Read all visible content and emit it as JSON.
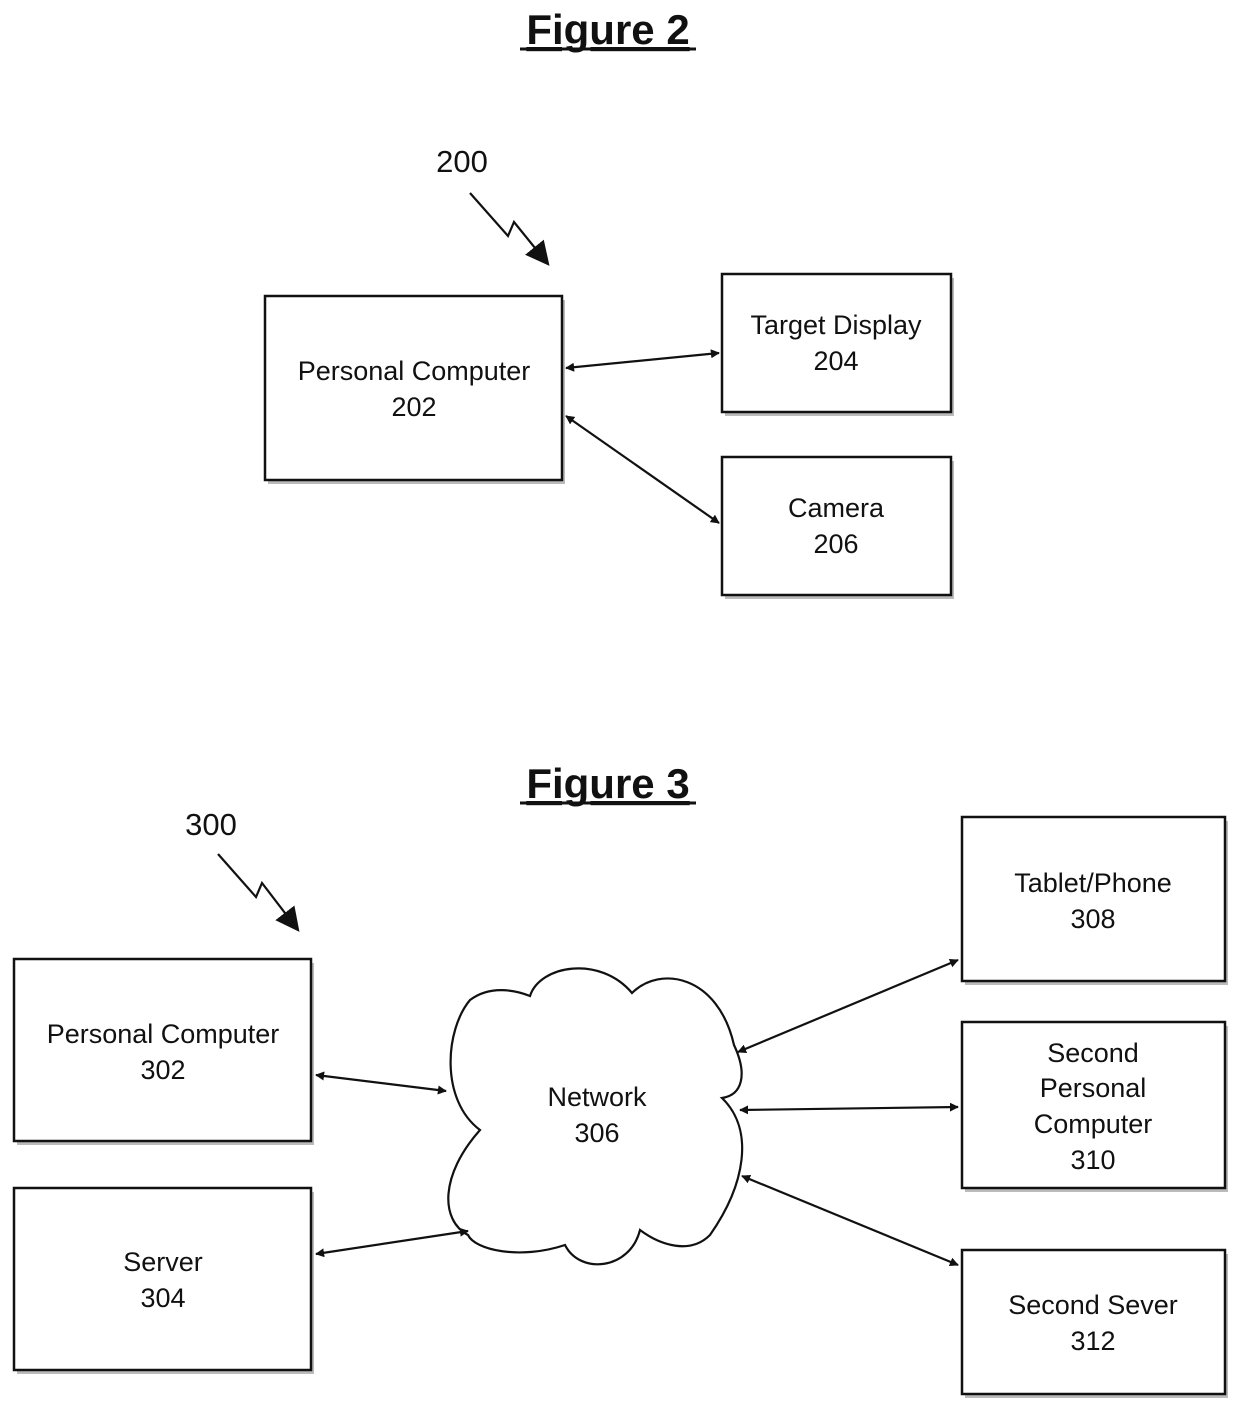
{
  "figure2": {
    "title": "Figure 2",
    "ref": "200",
    "nodes": {
      "pc": {
        "name": "Personal Computer",
        "num": "202"
      },
      "display": {
        "name": "Target Display",
        "num": "204"
      },
      "camera": {
        "name": "Camera",
        "num": "206"
      }
    },
    "edges": [
      {
        "from": "Personal Computer 202",
        "to": "Target Display 204",
        "direction": "bidirectional"
      },
      {
        "from": "Personal Computer 202",
        "to": "Camera 206",
        "direction": "bidirectional"
      }
    ]
  },
  "figure3": {
    "title": "Figure 3",
    "ref": "300",
    "nodes": {
      "pc": {
        "name": "Personal Computer",
        "num": "302"
      },
      "server": {
        "name": "Server",
        "num": "304"
      },
      "network": {
        "name": "Network",
        "num": "306"
      },
      "tablet": {
        "name": "Tablet/Phone",
        "num": "308"
      },
      "pc2": {
        "lines": [
          "Second",
          "Personal",
          "Computer"
        ],
        "num": "310"
      },
      "server2": {
        "name": "Second Sever",
        "num": "312"
      }
    },
    "edges": [
      {
        "from": "Personal Computer 302",
        "to": "Network 306",
        "direction": "bidirectional"
      },
      {
        "from": "Server 304",
        "to": "Network 306",
        "direction": "bidirectional"
      },
      {
        "from": "Network 306",
        "to": "Tablet/Phone 308",
        "direction": "bidirectional"
      },
      {
        "from": "Network 306",
        "to": "Second Personal Computer 310",
        "direction": "bidirectional"
      },
      {
        "from": "Network 306",
        "to": "Second Sever 312",
        "direction": "bidirectional"
      }
    ]
  }
}
